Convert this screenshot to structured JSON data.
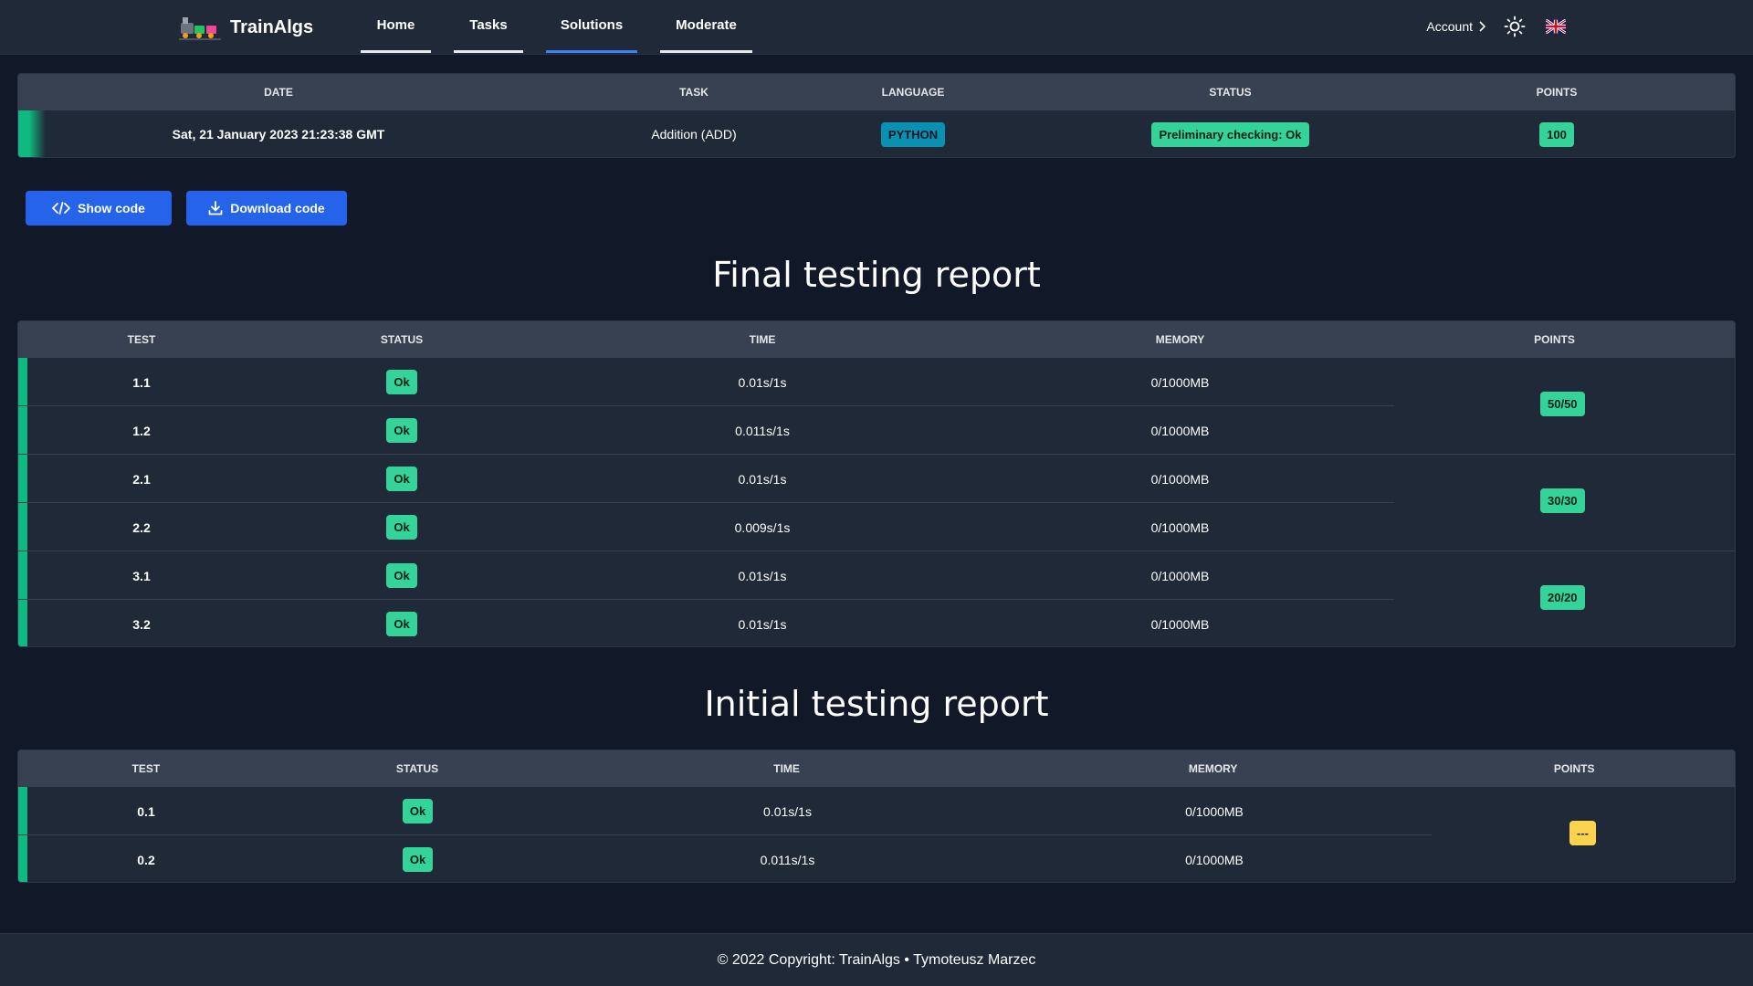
{
  "nav": {
    "brand": "TrainAlgs",
    "links": [
      "Home",
      "Tasks",
      "Solutions",
      "Moderate"
    ],
    "active": "Solutions",
    "account_label": "Account"
  },
  "summary": {
    "headers": [
      "DATE",
      "TASK",
      "LANGUAGE",
      "STATUS",
      "POINTS"
    ],
    "date": "Sat, 21 January 2023 21:23:38 GMT",
    "task": "Addition (ADD)",
    "language": "PYTHON",
    "status": "Preliminary checking: Ok",
    "points": "100"
  },
  "buttons": {
    "show_code": "Show code",
    "download_code": "Download code"
  },
  "final_report": {
    "title": "Final testing report",
    "headers": [
      "TEST",
      "STATUS",
      "TIME",
      "MEMORY",
      "POINTS"
    ],
    "rows": [
      {
        "test": "1.1",
        "status": "Ok",
        "time": "0.01s/1s",
        "memory": "0/1000MB"
      },
      {
        "test": "1.2",
        "status": "Ok",
        "time": "0.011s/1s",
        "memory": "0/1000MB"
      },
      {
        "test": "2.1",
        "status": "Ok",
        "time": "0.01s/1s",
        "memory": "0/1000MB"
      },
      {
        "test": "2.2",
        "status": "Ok",
        "time": "0.009s/1s",
        "memory": "0/1000MB"
      },
      {
        "test": "3.1",
        "status": "Ok",
        "time": "0.01s/1s",
        "memory": "0/1000MB"
      },
      {
        "test": "3.2",
        "status": "Ok",
        "time": "0.01s/1s",
        "memory": "0/1000MB"
      }
    ],
    "groups": [
      "50/50",
      "30/30",
      "20/20"
    ]
  },
  "initial_report": {
    "title": "Initial testing report",
    "headers": [
      "TEST",
      "STATUS",
      "TIME",
      "MEMORY",
      "POINTS"
    ],
    "rows": [
      {
        "test": "0.1",
        "status": "Ok",
        "time": "0.01s/1s",
        "memory": "0/1000MB"
      },
      {
        "test": "0.2",
        "status": "Ok",
        "time": "0.011s/1s",
        "memory": "0/1000MB"
      }
    ],
    "groups": [
      "---"
    ]
  },
  "footer": {
    "text": "© 2022 Copyright: TrainAlgs • Tymoteusz Marzec"
  },
  "colors": {
    "background": "#111827",
    "surface": "#1f2937",
    "header": "#374151",
    "accent_green": "#34d399",
    "primary_blue": "#2563eb",
    "cyan": "#0891b2",
    "yellow": "#fcd34d"
  }
}
